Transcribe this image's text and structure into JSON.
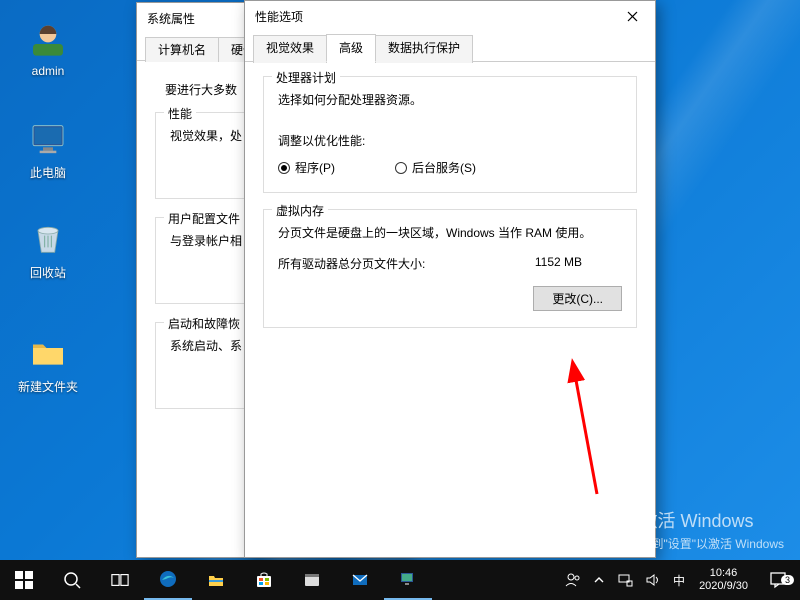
{
  "desktop": {
    "icons": [
      {
        "name": "admin",
        "label": "admin",
        "kind": "user"
      },
      {
        "name": "this-pc",
        "label": "此电脑",
        "kind": "pc"
      },
      {
        "name": "recycle-bin",
        "label": "回收站",
        "kind": "bin"
      },
      {
        "name": "new-folder",
        "label": "新建文件夹",
        "kind": "folder"
      }
    ]
  },
  "sysprops": {
    "title": "系统属性",
    "tabs": [
      "计算机名",
      "硬件"
    ],
    "intro": "要进行大多数",
    "groups": {
      "perf": {
        "legend": "性能",
        "text": "视觉效果，处"
      },
      "profiles": {
        "legend": "用户配置文件",
        "text": "与登录帐户相"
      },
      "startup": {
        "legend": "启动和故障恢",
        "text": "系统启动、系"
      }
    }
  },
  "perfopts": {
    "title": "性能选项",
    "tabs": [
      "视觉效果",
      "高级",
      "数据执行保护"
    ],
    "active_tab": 1,
    "cpu": {
      "legend": "处理器计划",
      "desc": "选择如何分配处理器资源。",
      "adjust_label": "调整以优化性能:",
      "radio_program": "程序(P)",
      "radio_service": "后台服务(S)"
    },
    "vm": {
      "legend": "虚拟内存",
      "desc": "分页文件是硬盘上的一块区域，Windows 当作 RAM 使用。",
      "total_label": "所有驱动器总分页文件大小:",
      "total_value": "1152 MB",
      "change_btn": "更改(C)..."
    }
  },
  "watermark": {
    "line1": "激活 Windows",
    "line2": "转到\"设置\"以激活 Windows"
  },
  "taskbar": {
    "clock_time": "10:46",
    "clock_date": "2020/9/30",
    "ime": "中",
    "notif_count": "3"
  }
}
